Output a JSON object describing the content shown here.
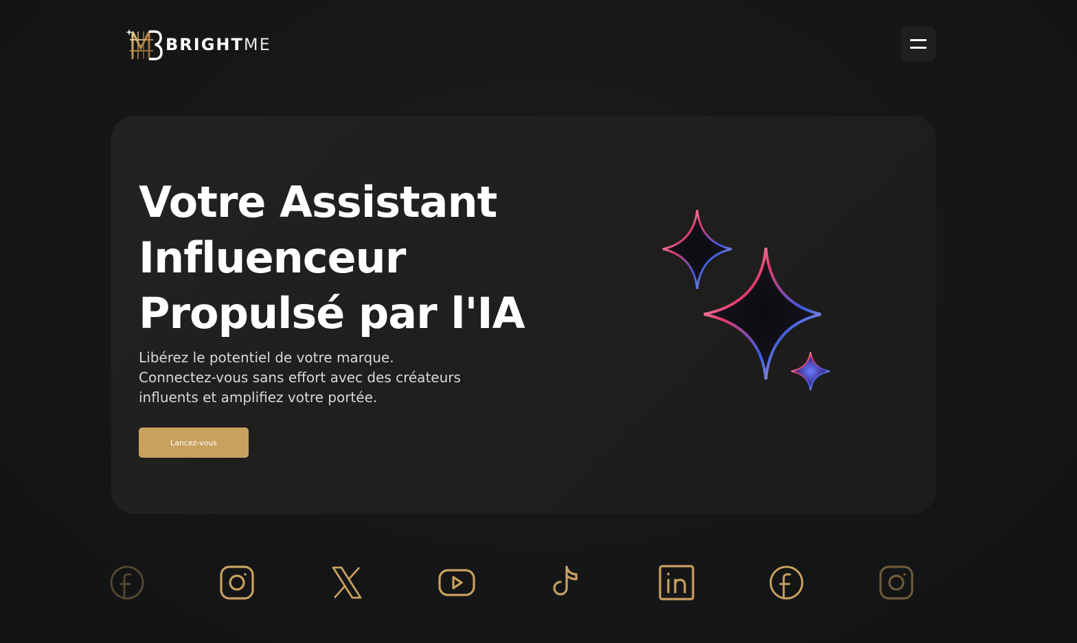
{
  "brand": {
    "name_bold": "BRIGHT",
    "name_light": "ME",
    "accent_color": "#c9a15f"
  },
  "header": {
    "menu_icon": "hamburger-menu-icon"
  },
  "hero": {
    "title_lines": [
      "Votre Assistant",
      "Influenceur",
      "Propulsé par l'IA"
    ],
    "subtitle_lines": [
      "Libérez le potentiel de votre marque.",
      "Connectez-vous sans effort avec des créateurs",
      "influents et amplifiez votre portée."
    ],
    "cta_label": "Lancez-vous",
    "illustration": "sparkles-icon"
  },
  "social": {
    "icons": [
      "facebook-icon",
      "instagram-icon",
      "x-icon",
      "youtube-icon",
      "tiktok-icon",
      "linkedin-icon",
      "facebook-icon",
      "instagram-icon"
    ],
    "icon_color": "#c9a15f"
  }
}
